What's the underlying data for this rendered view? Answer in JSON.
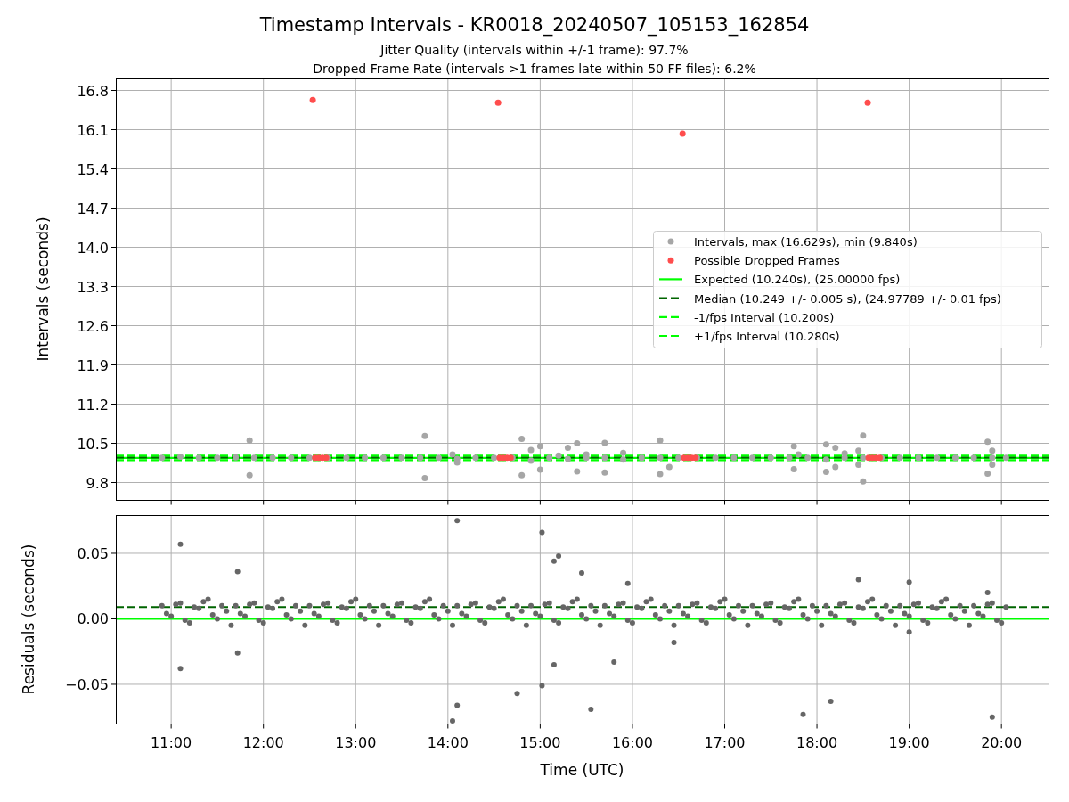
{
  "figure": {
    "title": "Timestamp Intervals - KR0018_20240507_105153_162854",
    "subtitles": [
      "Jitter Quality (intervals within +/-1 frame): 97.7%",
      "Dropped Frame Rate (intervals >1 frames late within 50 FF files): 6.2%"
    ]
  },
  "interval_panel": {
    "chart_data": {
      "type": "scatter",
      "ylabel": "Intervals (seconds)",
      "xlim": [
        10.4,
        20.51
      ],
      "ylim": [
        9.482,
        17.007
      ],
      "yticks": [
        9.8,
        10.5,
        11.2,
        11.9,
        12.6,
        13.3,
        {
          "value": 14,
          "label": "14.0"
        },
        14.7,
        15.4,
        16.1,
        16.8
      ],
      "grid": true,
      "legend": "center right",
      "series": [
        {
          "name": "Intervals, max (16.629s), min (9.840s)",
          "color": "#a6a6a6",
          "x": [
            10.9,
            11.1,
            11.3,
            11.5,
            11.7,
            11.9,
            12.1,
            12.3,
            12.5,
            12.7,
            12.9,
            13.1,
            13.3,
            13.5,
            13.7,
            13.9,
            14.1,
            14.3,
            14.5,
            14.7,
            14.9,
            15.1,
            15.3,
            15.5,
            15.7,
            15.9,
            16.1,
            16.3,
            16.5,
            16.7,
            16.9,
            17.1,
            17.3,
            17.5,
            17.7,
            17.9,
            18.1,
            18.3,
            18.5,
            18.7,
            18.9,
            19.1,
            19.3,
            19.5,
            19.7,
            19.9,
            20.05,
            11.85,
            11.85,
            13.75,
            13.75,
            14.05,
            14.1,
            14.8,
            14.8,
            14.9,
            15.0,
            15.0,
            15.2,
            15.3,
            15.4,
            15.4,
            15.5,
            15.7,
            15.7,
            15.9,
            16.3,
            16.3,
            16.4,
            17.75,
            17.75,
            17.8,
            18.1,
            18.1,
            18.2,
            18.2,
            18.3,
            18.45,
            18.45,
            18.5,
            18.5,
            19.85,
            19.85,
            19.9,
            19.9
          ],
          "values": [
            10.24,
            10.26,
            10.24,
            10.24,
            10.25,
            10.24,
            10.24,
            10.24,
            10.24,
            10.24,
            10.24,
            10.24,
            10.24,
            10.24,
            10.24,
            10.24,
            10.22,
            10.24,
            10.24,
            10.24,
            10.19,
            10.24,
            10.22,
            10.24,
            10.24,
            10.21,
            10.24,
            10.24,
            10.24,
            10.24,
            10.24,
            10.24,
            10.24,
            10.24,
            10.24,
            10.24,
            10.21,
            10.24,
            10.24,
            10.24,
            10.24,
            10.24,
            10.24,
            10.24,
            10.24,
            10.24,
            10.24,
            10.55,
            9.93,
            10.63,
            9.88,
            10.3,
            10.16,
            10.58,
            9.93,
            10.38,
            10.45,
            10.03,
            10.28,
            10.42,
            10.5,
            10.0,
            10.3,
            10.51,
            9.98,
            10.33,
            10.55,
            9.95,
            10.08,
            10.45,
            10.04,
            10.3,
            10.48,
            9.99,
            10.42,
            10.08,
            10.32,
            10.37,
            10.12,
            10.64,
            9.82,
            10.53,
            9.96,
            10.37,
            10.12
          ]
        },
        {
          "name": "Possible Dropped Frames",
          "color": "#ff4d4d",
          "x": [
            12.535,
            12.56,
            12.6,
            12.64,
            12.68,
            14.544,
            14.56,
            14.6,
            14.64,
            14.68,
            16.543,
            16.56,
            16.6,
            16.64,
            16.68,
            18.55,
            18.56,
            18.6,
            18.64,
            18.68
          ],
          "values": [
            16.63,
            10.24,
            10.24,
            10.24,
            10.24,
            16.58,
            10.24,
            10.24,
            10.24,
            10.24,
            16.03,
            10.24,
            10.24,
            10.24,
            10.24,
            16.58,
            10.24,
            10.24,
            10.24,
            10.24
          ]
        }
      ],
      "ref_lines": [
        {
          "axis": "y",
          "label": "Expected (10.240s), (25.00000 fps)",
          "color": "#00ff00",
          "value": 10.24
        },
        {
          "axis": "y",
          "label": "Median (10.249 +/- 0.005 s), (24.97789 +/- 0.01 fps)",
          "color": "#006400",
          "value": 10.249
        },
        {
          "axis": "y",
          "label": "-1/fps Interval (10.200s)",
          "color": "#00ff00",
          "value": 10.2
        },
        {
          "axis": "y",
          "label": "+1/fps Interval (10.280s)",
          "color": "#00ff00",
          "value": 10.28
        }
      ]
    }
  },
  "residual_panel": {
    "chart_data": {
      "type": "scatter",
      "xlabel": "Time (UTC)",
      "ylabel": "Residuals (seconds)",
      "xlim": [
        10.4,
        20.51
      ],
      "ylim": [
        -0.0803,
        0.0789
      ],
      "xticks": [
        {
          "value": 11,
          "label": "11:00"
        },
        {
          "value": 12,
          "label": "12:00"
        },
        {
          "value": 13,
          "label": "13:00"
        },
        {
          "value": 14,
          "label": "14:00"
        },
        {
          "value": 15,
          "label": "15:00"
        },
        {
          "value": 16,
          "label": "16:00"
        },
        {
          "value": 17,
          "label": "17:00"
        },
        {
          "value": 18,
          "label": "18:00"
        },
        {
          "value": 19,
          "label": "19:00"
        },
        {
          "value": 20,
          "label": "20:00"
        }
      ],
      "yticks": [
        {
          "value": -0.05,
          "label": "−0.05"
        },
        {
          "value": 0,
          "label": "0.00"
        },
        {
          "value": 0.05,
          "label": "0.05"
        }
      ],
      "grid": true,
      "series": [
        {
          "color": "#666666",
          "x": [
            10.9,
            11.0,
            11.1,
            11.2,
            11.3,
            11.4,
            11.5,
            11.6,
            11.7,
            11.8,
            11.9,
            12.0,
            12.1,
            12.2,
            12.3,
            12.4,
            12.5,
            12.6,
            12.7,
            12.8,
            12.9,
            13.0,
            13.1,
            13.2,
            13.3,
            13.4,
            13.5,
            13.6,
            13.7,
            13.8,
            13.9,
            14.0,
            14.1,
            14.2,
            14.3,
            14.4,
            14.5,
            14.6,
            14.7,
            14.8,
            14.9,
            15.0,
            15.1,
            15.2,
            15.3,
            15.4,
            15.5,
            15.6,
            15.7,
            15.8,
            15.9,
            16.0,
            16.1,
            16.2,
            16.3,
            16.4,
            16.5,
            16.6,
            16.7,
            16.8,
            16.9,
            17.0,
            17.1,
            17.2,
            17.3,
            17.4,
            17.5,
            17.6,
            17.7,
            17.8,
            17.9,
            18.0,
            18.1,
            18.2,
            18.3,
            18.4,
            18.5,
            18.6,
            18.7,
            18.8,
            18.9,
            19.0,
            19.1,
            19.2,
            19.3,
            19.4,
            19.5,
            19.6,
            19.7,
            19.8,
            19.9,
            20.0,
            10.95,
            11.05,
            11.15,
            11.25,
            11.35,
            11.45,
            11.55,
            11.65,
            11.75,
            11.85,
            11.95,
            12.05,
            12.15,
            12.25,
            12.35,
            12.45,
            12.55,
            12.65,
            12.75,
            12.85,
            12.95,
            13.05,
            13.15,
            13.25,
            13.35,
            13.45,
            13.55,
            13.65,
            13.75,
            13.85,
            13.95,
            14.05,
            14.15,
            14.25,
            14.35,
            14.45,
            14.55,
            14.65,
            14.75,
            14.85,
            14.95,
            15.05,
            15.15,
            15.25,
            15.35,
            15.45,
            15.55,
            15.65,
            15.75,
            15.85,
            15.95,
            16.05,
            16.15,
            16.25,
            16.35,
            16.45,
            16.55,
            16.65,
            16.75,
            16.85,
            16.95,
            17.05,
            17.15,
            17.25,
            17.35,
            17.45,
            17.55,
            17.65,
            17.75,
            17.85,
            17.95,
            18.05,
            18.15,
            18.25,
            18.35,
            18.45,
            18.55,
            18.65,
            18.75,
            18.85,
            18.95,
            19.05,
            19.15,
            19.25,
            19.35,
            19.45,
            19.55,
            19.65,
            19.75,
            19.85,
            19.95,
            20.05,
            11.1,
            11.1,
            11.72,
            11.72,
            14.1,
            14.05,
            14.1,
            15.02,
            15.02,
            15.2,
            15.15,
            15.15,
            14.75,
            15.45,
            15.55,
            15.8,
            15.95,
            16.45,
            17.85,
            18.15,
            18.45,
            19.0,
            19.0,
            19.9,
            19.85
          ],
          "values": [
            0.01,
            0.002,
            0.012,
            -0.003,
            0.008,
            0.015,
            0.0,
            0.006,
            0.01,
            0.002,
            0.012,
            -0.003,
            0.008,
            0.015,
            0.0,
            0.006,
            0.01,
            0.002,
            0.012,
            -0.003,
            0.008,
            0.015,
            0.0,
            0.006,
            0.01,
            0.002,
            0.012,
            -0.003,
            0.008,
            0.015,
            0.0,
            0.006,
            0.01,
            0.002,
            0.012,
            -0.003,
            0.008,
            0.015,
            0.0,
            0.006,
            0.01,
            0.002,
            0.012,
            -0.003,
            0.008,
            0.015,
            0.0,
            0.006,
            0.01,
            0.002,
            0.012,
            -0.003,
            0.008,
            0.015,
            0.0,
            0.006,
            0.01,
            0.002,
            0.012,
            -0.003,
            0.008,
            0.015,
            0.0,
            0.006,
            0.01,
            0.002,
            0.012,
            -0.003,
            0.008,
            0.015,
            0.0,
            0.006,
            0.01,
            0.002,
            0.012,
            -0.003,
            0.008,
            0.015,
            0.0,
            0.006,
            0.01,
            0.002,
            0.012,
            -0.003,
            0.008,
            0.015,
            0.0,
            0.006,
            0.01,
            0.002,
            0.012,
            -0.003,
            0.004,
            0.011,
            -0.001,
            0.009,
            0.013,
            0.003,
            0.01,
            -0.005,
            0.004,
            0.011,
            -0.001,
            0.009,
            0.013,
            0.003,
            0.01,
            -0.005,
            0.004,
            0.011,
            -0.001,
            0.009,
            0.013,
            0.003,
            0.01,
            -0.005,
            0.004,
            0.011,
            -0.001,
            0.009,
            0.013,
            0.003,
            0.01,
            -0.005,
            0.004,
            0.011,
            -0.001,
            0.009,
            0.013,
            0.003,
            0.01,
            -0.005,
            0.004,
            0.011,
            -0.001,
            0.009,
            0.013,
            0.003,
            0.01,
            -0.005,
            0.004,
            0.011,
            -0.001,
            0.009,
            0.013,
            0.003,
            0.01,
            -0.005,
            0.004,
            0.011,
            -0.001,
            0.009,
            0.013,
            0.003,
            0.01,
            -0.005,
            0.004,
            0.011,
            -0.001,
            0.009,
            0.013,
            0.003,
            0.01,
            -0.005,
            0.004,
            0.011,
            -0.001,
            0.009,
            0.013,
            0.003,
            0.01,
            -0.005,
            0.004,
            0.011,
            -0.001,
            0.009,
            0.013,
            0.003,
            0.01,
            -0.005,
            0.004,
            0.011,
            -0.001,
            0.009,
            0.057,
            -0.038,
            0.036,
            -0.026,
            0.075,
            -0.078,
            -0.066,
            0.066,
            -0.051,
            0.048,
            0.044,
            -0.035,
            -0.057,
            0.035,
            -0.069,
            -0.033,
            0.027,
            -0.018,
            -0.073,
            -0.063,
            0.03,
            -0.01,
            0.028,
            -0.075,
            0.02
          ]
        }
      ],
      "ref_lines": [
        {
          "axis": "y",
          "color": "#00ff00",
          "value": 0
        },
        {
          "axis": "y",
          "color": "#006400",
          "value": 0.009
        }
      ]
    }
  }
}
